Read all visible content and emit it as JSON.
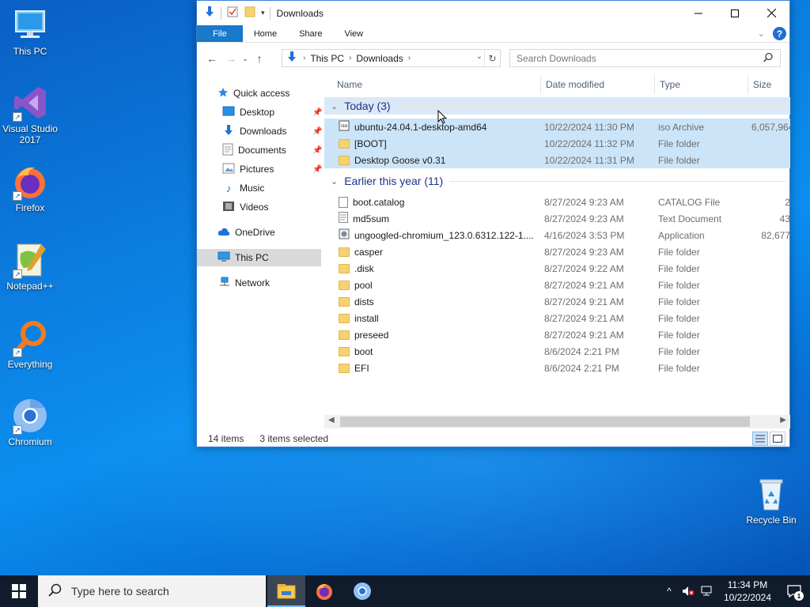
{
  "desktop": {
    "icons": [
      {
        "label": "This PC"
      },
      {
        "label": "Visual Studio 2017"
      },
      {
        "label": "Firefox"
      },
      {
        "label": "Notepad++"
      },
      {
        "label": "Everything"
      },
      {
        "label": "Chromium"
      },
      {
        "label": "Recycle Bin"
      }
    ]
  },
  "window": {
    "title": "Downloads",
    "ribbon_tabs": [
      "File",
      "Home",
      "Share",
      "View"
    ],
    "address": {
      "crumbs": [
        "This PC",
        "Downloads"
      ]
    },
    "search": {
      "placeholder": "Search Downloads"
    },
    "nav": {
      "quick_access": "Quick access",
      "items": [
        "Desktop",
        "Downloads",
        "Documents",
        "Pictures",
        "Music",
        "Videos"
      ],
      "onedrive": "OneDrive",
      "this_pc": "This PC",
      "network": "Network"
    },
    "columns": {
      "name": "Name",
      "date": "Date modified",
      "type": "Type",
      "size": "Size"
    },
    "groups": [
      {
        "label": "Today (3)",
        "rows": [
          {
            "name": "ubuntu-24.04.1-desktop-amd64",
            "date": "10/22/2024 11:30 PM",
            "type": "iso Archive",
            "size": "6,057,964"
          },
          {
            "name": "[BOOT]",
            "date": "10/22/2024 11:32 PM",
            "type": "File folder",
            "size": ""
          },
          {
            "name": "Desktop Goose v0.31",
            "date": "10/22/2024 11:31 PM",
            "type": "File folder",
            "size": ""
          }
        ]
      },
      {
        "label": "Earlier this year (11)",
        "rows": [
          {
            "name": "boot.catalog",
            "date": "8/27/2024 9:23 AM",
            "type": "CATALOG File",
            "size": "2"
          },
          {
            "name": "md5sum",
            "date": "8/27/2024 9:23 AM",
            "type": "Text Document",
            "size": "43"
          },
          {
            "name": "ungoogled-chromium_123.0.6312.122-1....",
            "date": "4/16/2024 3:53 PM",
            "type": "Application",
            "size": "82,677"
          },
          {
            "name": "casper",
            "date": "8/27/2024 9:23 AM",
            "type": "File folder",
            "size": ""
          },
          {
            "name": ".disk",
            "date": "8/27/2024 9:22 AM",
            "type": "File folder",
            "size": ""
          },
          {
            "name": "pool",
            "date": "8/27/2024 9:21 AM",
            "type": "File folder",
            "size": ""
          },
          {
            "name": "dists",
            "date": "8/27/2024 9:21 AM",
            "type": "File folder",
            "size": ""
          },
          {
            "name": "install",
            "date": "8/27/2024 9:21 AM",
            "type": "File folder",
            "size": ""
          },
          {
            "name": "preseed",
            "date": "8/27/2024 9:21 AM",
            "type": "File folder",
            "size": ""
          },
          {
            "name": "boot",
            "date": "8/6/2024 2:21 PM",
            "type": "File folder",
            "size": ""
          },
          {
            "name": "EFI",
            "date": "8/6/2024 2:21 PM",
            "type": "File folder",
            "size": ""
          }
        ]
      }
    ],
    "status": {
      "items": "14 items",
      "selected": "3 items selected"
    }
  },
  "taskbar": {
    "search_placeholder": "Type here to search",
    "clock_time": "11:34 PM",
    "clock_date": "10/22/2024",
    "notification_count": "1"
  },
  "colors": {
    "accent": "#1979ca",
    "selection": "#cce4f7",
    "taskbar": "#101c2b"
  }
}
